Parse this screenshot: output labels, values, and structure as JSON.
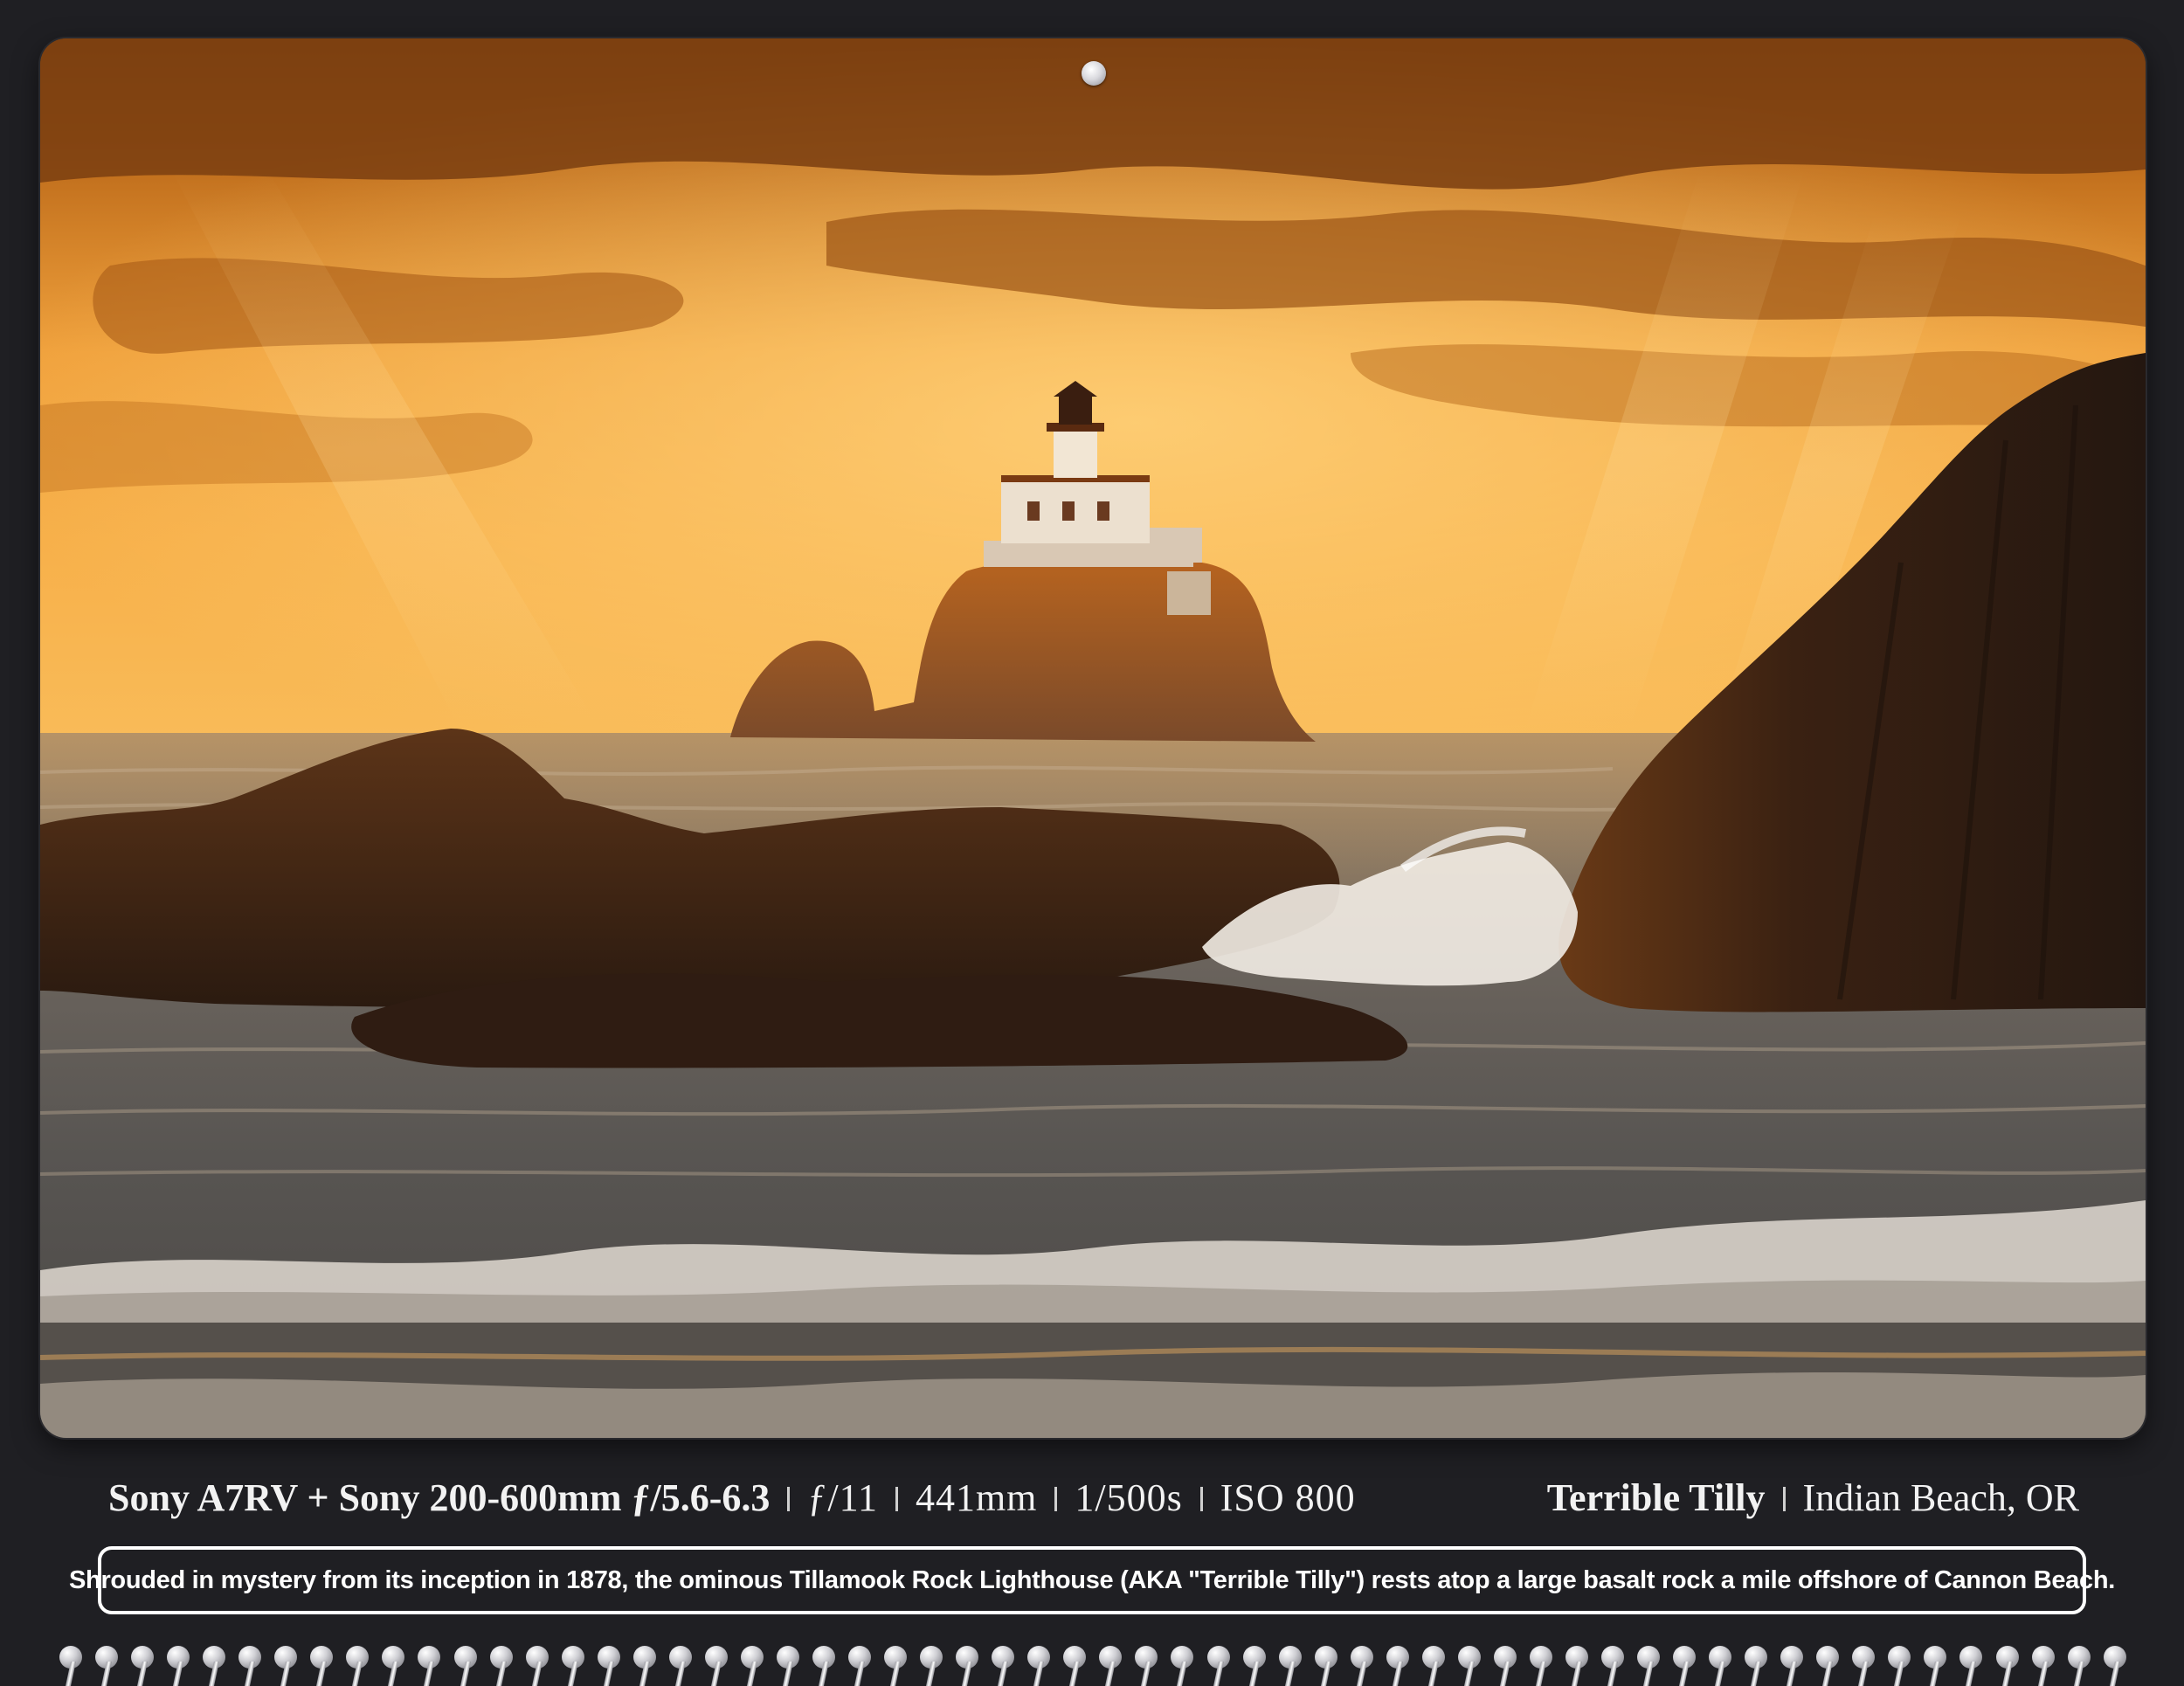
{
  "photo": {
    "subject": "Tillamook Rock Lighthouse at sunset"
  },
  "info": {
    "camera": "Sony A7RV + Sony 200-600mm ƒ/5.6-6.3",
    "aperture": "ƒ/11",
    "focal_length": "441mm",
    "shutter": "1/500s",
    "iso": "ISO 800",
    "title": "Terrible Tilly",
    "location": "Indian Beach, OR"
  },
  "caption": {
    "text": "Shrouded in mystery from its inception in 1878,  the ominous Tillamook Rock Lighthouse (AKA \"Terrible Tilly\") rests atop a large basalt rock a mile offshore of Cannon Beach."
  },
  "colors": {
    "background": "#1f1f23",
    "sky_bright": "#f3a43a",
    "sky_dark": "#a85a14",
    "text": "#f2f2f2"
  },
  "binding": {
    "ring_count": 58
  }
}
